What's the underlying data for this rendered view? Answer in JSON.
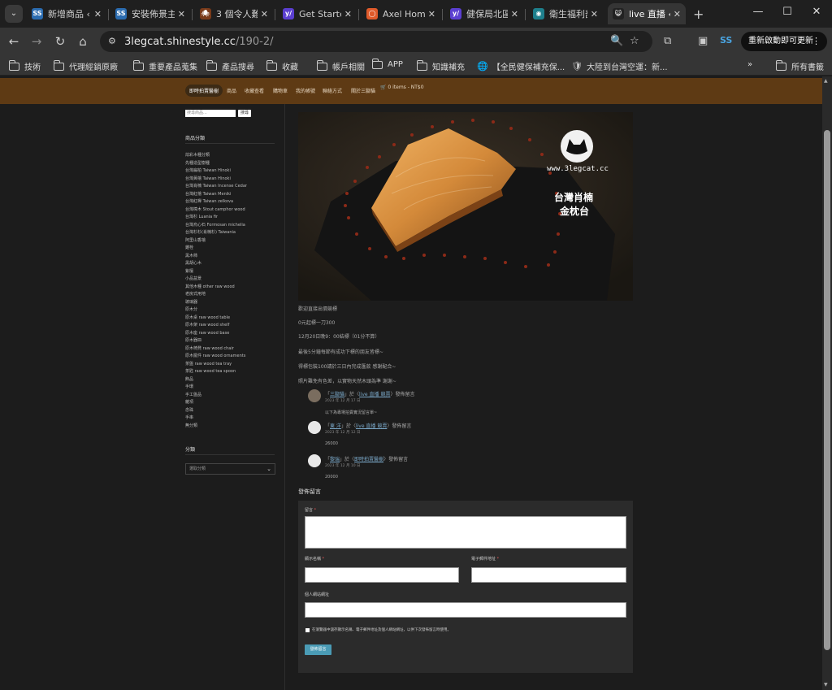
{
  "tabs": [
    {
      "title": "新增商品 ‹",
      "favicon": "SS",
      "fav_color": "#2b6cb0"
    },
    {
      "title": "安裝佈景主",
      "favicon": "SS",
      "fav_color": "#2b6cb0"
    },
    {
      "title": "3 個令人難",
      "favicon": "🕷",
      "fav_color": "#7a3b1a"
    },
    {
      "title": "Get Starte",
      "favicon": "y/",
      "fav_color": "#5b3fd1"
    },
    {
      "title": "Axel Home",
      "favicon": "◯",
      "fav_color": "#e05a2a"
    },
    {
      "title": "健保局北區",
      "favicon": "y/",
      "fav_color": "#5b3fd1"
    },
    {
      "title": "衛生福利部",
      "favicon": "◉",
      "fav_color": "#1e7f8c"
    },
    {
      "title": "live 直播 ‹",
      "favicon": "😺",
      "fav_color": "#222222"
    }
  ],
  "toolbar": {
    "url_host": "3legcat.shinestyle.cc",
    "url_path": "/190-2/",
    "update_label": "重新啟動即可更新"
  },
  "bookmarks": [
    {
      "label": "技術",
      "icon": "folder-icon"
    },
    {
      "label": "代理經銷原廠",
      "icon": "folder-icon"
    },
    {
      "label": "重要產品蒐集",
      "icon": "folder-icon"
    },
    {
      "label": "產品搜尋",
      "icon": "folder-icon"
    },
    {
      "label": "收藏",
      "icon": "folder-icon"
    },
    {
      "label": "帳戶相關",
      "icon": "folder-icon"
    },
    {
      "label": "APP",
      "icon": "folder-icon"
    },
    {
      "label": "知識補充",
      "icon": "folder-icon"
    },
    {
      "label": "【全民健保補充保...",
      "icon": "globe-icon"
    },
    {
      "label": "大陸到台灣空運：新...",
      "icon": "shield-icon"
    }
  ],
  "bookmarks_all": "所有書籤",
  "site_nav": {
    "items": [
      "即時拍賣醫樹",
      "商品",
      "收藏查看",
      "購物車",
      "我的帳號",
      "聯絡方式",
      "關於三腳貓"
    ],
    "cart": "🛒 0 items - NT$0"
  },
  "sidebar": {
    "search_placeholder": "搜尋商品...",
    "search_button": "搜尋",
    "categories_heading": "商品分類",
    "categories": [
      "炫彩木種分類",
      "先種造型樹種",
      "台灣扁柏 Taiwan Hinoki",
      "台灣黃檜 Taiwan Hinoki",
      "台灣肖楠 Taiwan Incense Cedar",
      "台灣紅檜 Taiwan Meniki",
      "台灣紅櫸 Taiwan zelkova",
      "台灣樟木 Stout camphor wood",
      "台灣杉 Luania fir",
      "台灣烏心石 Formosan michelia",
      "台灣杉杉(肖楠杉) Taiwania",
      "阿里山香檜",
      "雞栓",
      "黑木柿",
      "黑胡心木",
      "紫檀",
      "小品盆景",
      "其他木種 other raw wood",
      "老房式用地",
      "玻璃器",
      "原木分",
      "原木桌 raw wood table",
      "原木架 raw wood shelf",
      "原木座 raw wood base",
      "原木器皿",
      "原木椅凳 raw wood chair",
      "原木擺件 raw wood ornaments",
      "茶盤 raw wood tea tray",
      "茶匙 raw wood tea spoon",
      "飾品",
      "手環",
      "手工盤品",
      "雜項",
      "念珠",
      "手串",
      "無分類"
    ],
    "archive_heading": "分類",
    "archive_select": "選取分類"
  },
  "post": {
    "image_text_site": "www.3legcat.cc",
    "image_text_title_1": "台灣肖楠",
    "image_text_title_2": "金枕台",
    "lines": [
      "歡迎直接出價競標",
      "0元起標一刀300",
      "12月20日晚9：00結標（01分不算）",
      "最後5分鐘每節有成功下標的朋友皆標~",
      "得標包裝100請於三日內完成匯款 感謝配合~",
      "照片難免有色差，以實物天然木頭為準 謝謝~"
    ]
  },
  "comments": [
    {
      "author": "三腳貓",
      "post": "live 直播 競賣",
      "suffix": "發佈留言",
      "prefix": "「",
      "mid": "」於〈",
      "end": "〉",
      "date": "2023 年 12 月 17 日",
      "text": "以下為專場拍賣實況留言單~",
      "avatar": "cat"
    },
    {
      "author": "東 洋",
      "post": "live 直播 競賣",
      "suffix": "發佈留言",
      "prefix": "「",
      "mid": "」於〈",
      "end": "〉",
      "date": "2023 年 12 月 12 日",
      "text": "26000",
      "avatar": "blank"
    },
    {
      "author": "黎瑞",
      "post": "即時拍賣醫樹",
      "suffix": "發佈留言",
      "prefix": "「",
      "mid": "」於〈",
      "end": "〉",
      "date": "2023 年 12 月 10 日",
      "text": "20000",
      "avatar": "blank"
    }
  ],
  "reply": {
    "title": "發佈留言",
    "comment_label": "留言",
    "name_label": "顯示名稱",
    "email_label": "電子郵件地址",
    "website_label": "個人網站網址",
    "cookies_label": "在瀏覽器中儲存顯示名稱、電子郵件地址及個人網站網址，以供下次發佈留言時使用。",
    "required_mark": "*",
    "submit_label": "發佈留言"
  }
}
